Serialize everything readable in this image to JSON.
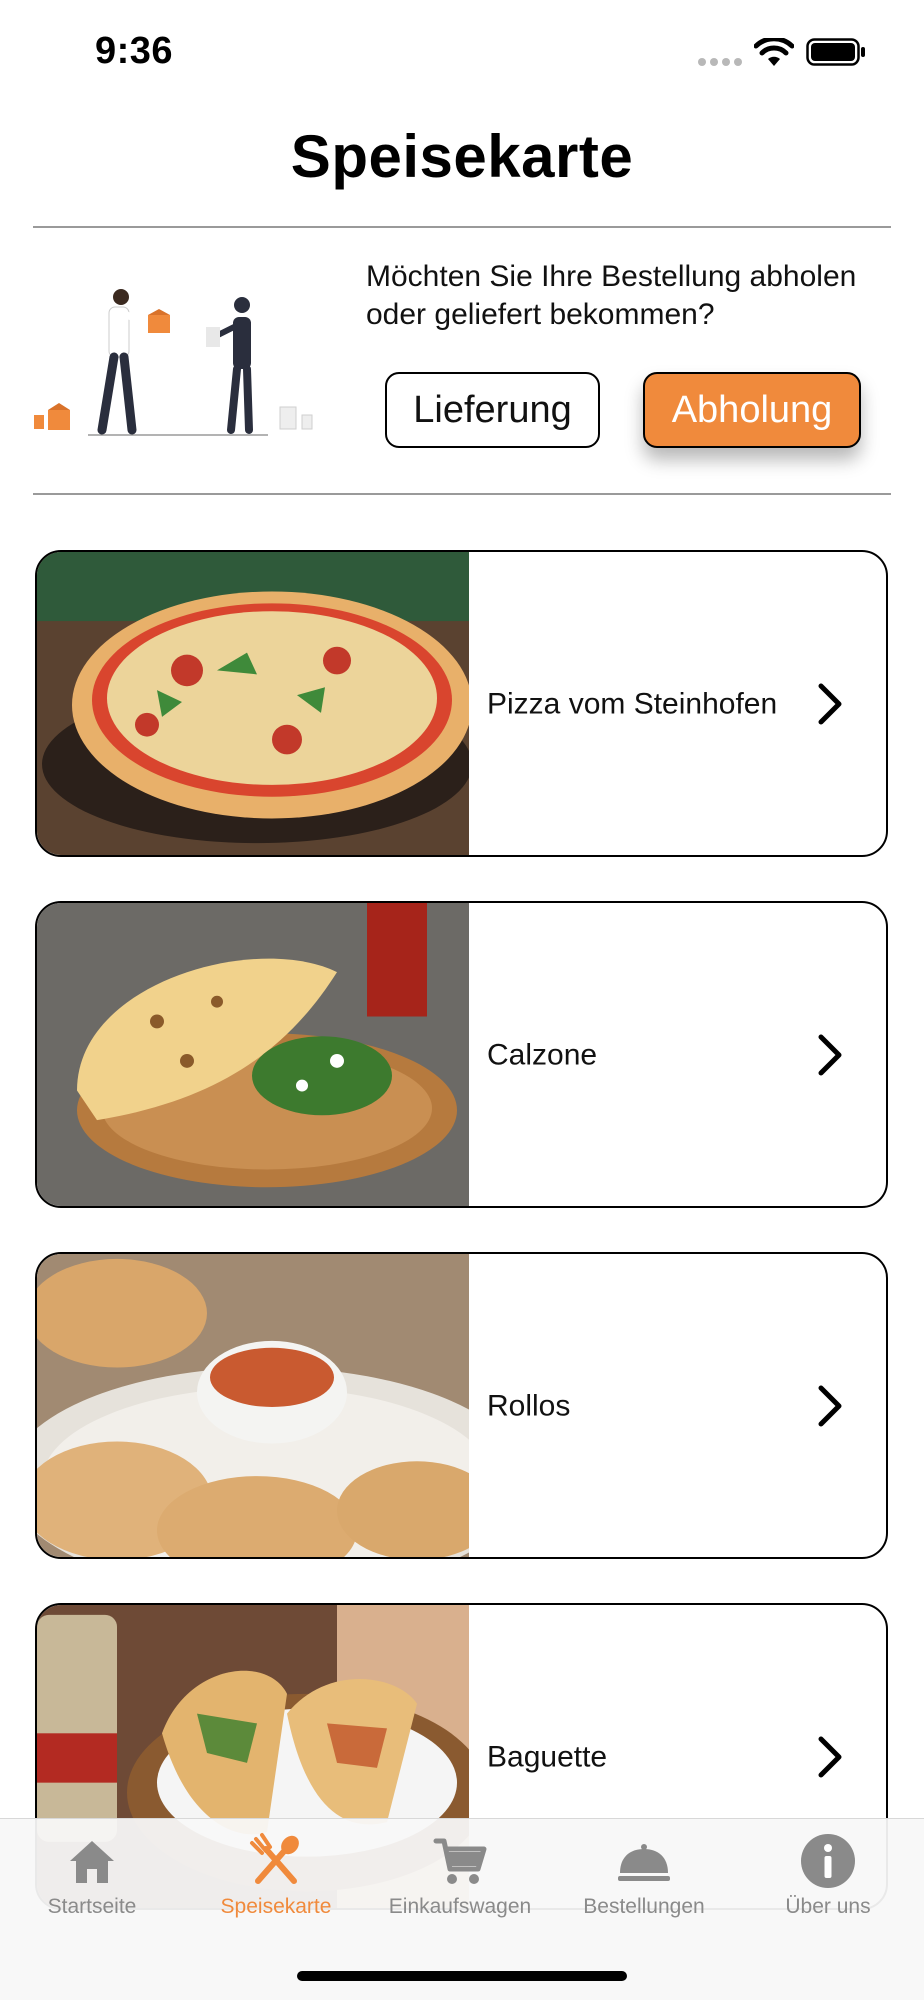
{
  "status_bar": {
    "time": "9:36",
    "signal_icon": "signal-dots-icon",
    "wifi_icon": "wifi-icon",
    "battery_icon": "battery-icon"
  },
  "header": {
    "title": "Speisekarte"
  },
  "delivery": {
    "question": "Möchten Sie Ihre Bestellung abholen oder geliefert bekommen?",
    "delivery_label": "Lieferung",
    "pickup_label": "Abholung",
    "selected": "Abholung",
    "illustration_icon": "delivery-handover-illustration"
  },
  "categories": [
    {
      "label": "Pizza vom Steinhofen",
      "image": "pizza-photo"
    },
    {
      "label": "Calzone",
      "image": "calzone-photo"
    },
    {
      "label": "Rollos",
      "image": "rollos-photo"
    },
    {
      "label": "Baguette",
      "image": "baguette-photo"
    }
  ],
  "tab_bar": {
    "active": "Speisekarte",
    "tabs": [
      {
        "label": "Startseite",
        "icon": "home-icon"
      },
      {
        "label": "Speisekarte",
        "icon": "cutlery-icon"
      },
      {
        "label": "Einkaufswagen",
        "icon": "cart-icon"
      },
      {
        "label": "Bestellungen",
        "icon": "cloche-icon"
      },
      {
        "label": "Über uns",
        "icon": "info-icon"
      }
    ]
  },
  "colors": {
    "accent": "#f08a3c",
    "inactive_tab": "#8a8a8a",
    "divider": "#9a9a9a"
  }
}
